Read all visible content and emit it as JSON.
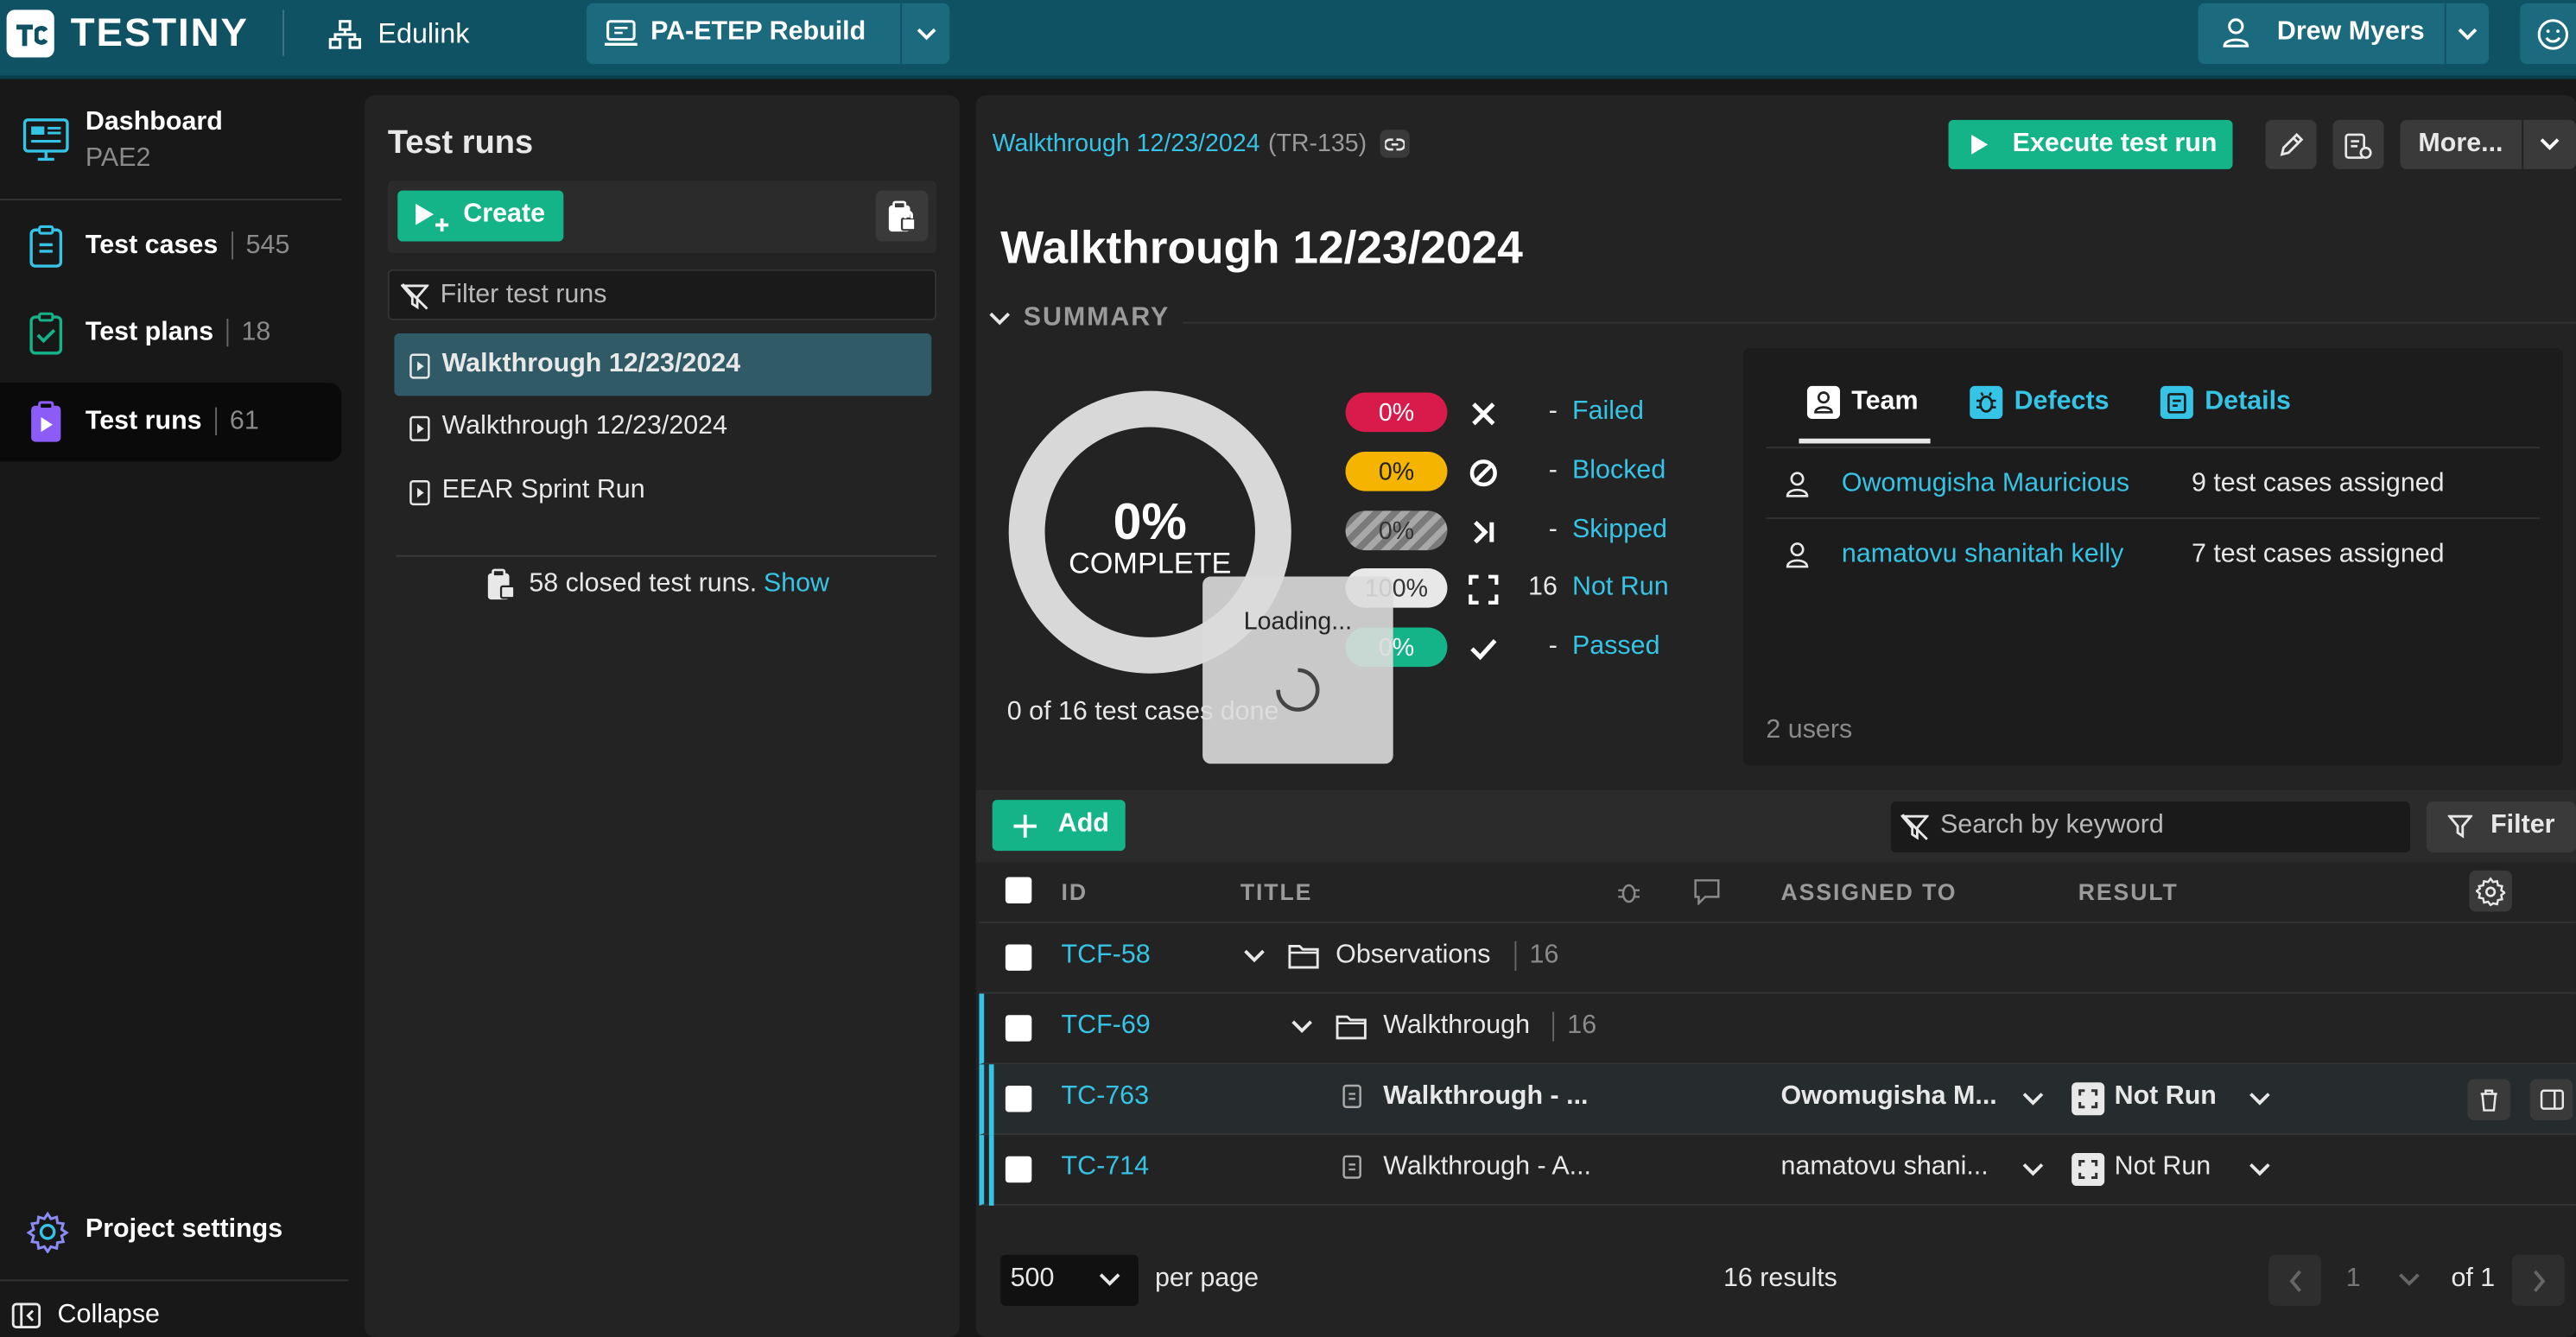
{
  "topbar": {
    "logo": "TESTINY",
    "org": "Edulink",
    "project": "PA-ETEP Rebuild",
    "user": "Drew Myers"
  },
  "nav": {
    "dashboard": "Dashboard",
    "dashboard_sub": "PAE2",
    "test_cases": "Test cases",
    "test_cases_count": "545",
    "test_plans": "Test plans",
    "test_plans_count": "18",
    "test_runs": "Test runs",
    "test_runs_count": "61",
    "project_settings": "Project settings",
    "collapse": "Collapse"
  },
  "runs_panel": {
    "title": "Test runs",
    "create": "Create",
    "filter_placeholder": "Filter test runs",
    "items": [
      "Walkthrough 12/23/2024",
      "Walkthrough 12/23/2024",
      "EEAR Sprint Run"
    ],
    "closed_text": "58 closed test runs.",
    "show": "Show"
  },
  "detail": {
    "breadcrumb": "Walkthrough 12/23/2024",
    "breadcrumb_id": "(TR-135)",
    "execute": "Execute test run",
    "more": "More...",
    "title": "Walkthrough 12/23/2024",
    "summary": "SUMMARY",
    "donut_pct": "0%",
    "donut_label": "COMPLETE",
    "done_text": "0 of 16 test cases done",
    "loading": "Loading...",
    "stats": [
      {
        "pct": "0%",
        "n": "-",
        "label": "Failed",
        "color": "#d81b4b"
      },
      {
        "pct": "0%",
        "n": "-",
        "label": "Blocked",
        "color": "#f5b400"
      },
      {
        "pct": "0%",
        "n": "-",
        "label": "Skipped",
        "color": "#9a9a9a"
      },
      {
        "pct": "100%",
        "n": "16",
        "label": "Not Run",
        "color": "#e8e8e8"
      },
      {
        "pct": "0%",
        "n": "-",
        "label": "Passed",
        "color": "#14b388"
      }
    ],
    "tabs": {
      "team": "Team",
      "defects": "Defects",
      "details": "Details"
    },
    "team": [
      {
        "name": "Owomugisha Mauricious",
        "assigned": "9 test cases assigned"
      },
      {
        "name": "namatovu shanitah kelly",
        "assigned": "7 test cases assigned"
      }
    ],
    "users_count": "2 users",
    "add": "Add",
    "search_placeholder": "Search by keyword",
    "filter": "Filter",
    "columns": {
      "id": "ID",
      "title": "TITLE",
      "assigned": "ASSIGNED TO",
      "result": "RESULT"
    },
    "rows": [
      {
        "id": "TCF-58",
        "title": "Observations",
        "count": "16"
      },
      {
        "id": "TCF-69",
        "title": "Walkthrough",
        "count": "16"
      },
      {
        "id": "TC-763",
        "title": "Walkthrough - ...",
        "assigned": "Owomugisha M...",
        "result": "Not Run"
      },
      {
        "id": "TC-714",
        "title": "Walkthrough - A...",
        "assigned": "namatovu shani...",
        "result": "Not Run"
      }
    ],
    "per_page_value": "500",
    "per_page": "per page",
    "results": "16 results",
    "page": "1",
    "of": "of 1"
  }
}
